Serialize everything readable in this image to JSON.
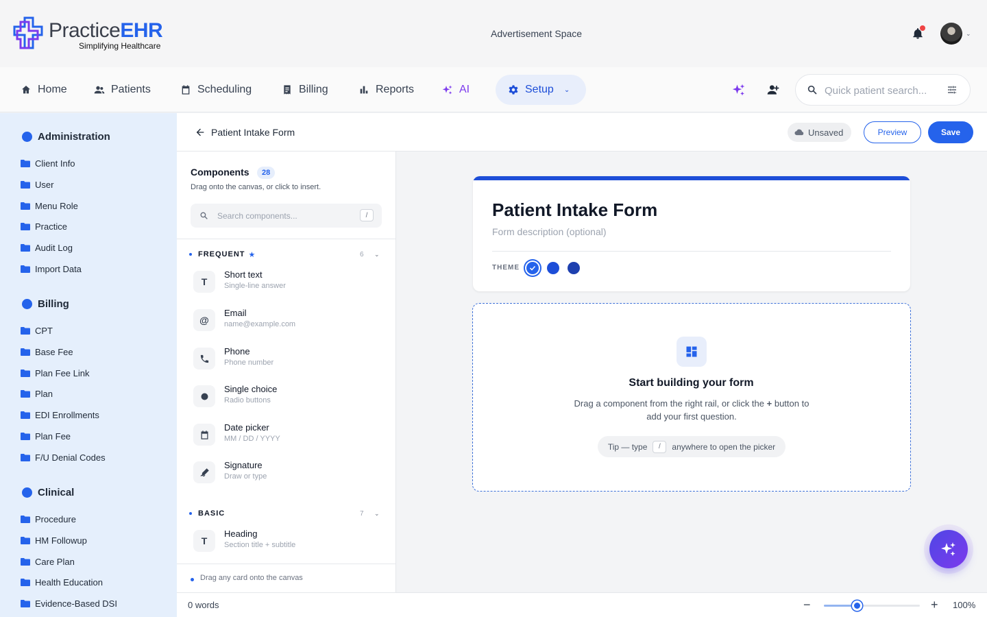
{
  "app": {
    "logo_name": "Practice",
    "logo_name_bold": "EHR",
    "tagline": "Simplifying Healthcare",
    "ad_space": "Advertisement Space",
    "brand_color": "#2563eb"
  },
  "nav": {
    "items": [
      {
        "label": "Home",
        "icon": "home-icon"
      },
      {
        "label": "Patients",
        "icon": "patients-icon"
      },
      {
        "label": "Scheduling",
        "icon": "calendar-icon"
      },
      {
        "label": "Billing",
        "icon": "receipt-icon"
      },
      {
        "label": "Reports",
        "icon": "bar-chart-icon"
      },
      {
        "label": "AI",
        "icon": "sparkle-icon"
      }
    ],
    "active": {
      "label": "Setup",
      "icon": "gear-icon"
    },
    "quick_search_placeholder": "Quick patient search..."
  },
  "sidebar": {
    "groups": [
      {
        "title": "Administration",
        "items": [
          "Client Info",
          "User",
          "Menu Role",
          "Practice",
          "Audit Log",
          "Import Data"
        ]
      },
      {
        "title": "Billing",
        "items": [
          "CPT",
          "Base Fee",
          "Plan Fee Link",
          "Plan",
          "EDI Enrollments",
          "Plan Fee",
          "F/U Denial Codes"
        ]
      },
      {
        "title": "Clinical",
        "items": [
          "Procedure",
          "HM Followup",
          "Care Plan",
          "Health Education",
          "Evidence-Based DSI"
        ]
      }
    ]
  },
  "form_header": {
    "title": "Patient Intake Form",
    "status": "Unsaved",
    "preview_label": "Preview",
    "save_label": "Save"
  },
  "components": {
    "title": "Components",
    "count": "28",
    "subtitle": "Drag onto the canvas, or click to insert.",
    "search_placeholder": "Search components...",
    "search_shortcut": "/",
    "sections": [
      {
        "name": "FREQUENT",
        "count": "6",
        "items": [
          {
            "label": "Short text",
            "hint": "Single-line answer",
            "icon": "T"
          },
          {
            "label": "Email",
            "hint": "name@example.com",
            "icon": "@"
          },
          {
            "label": "Phone",
            "hint": "Phone number",
            "icon": "phone-icon"
          },
          {
            "label": "Single choice",
            "hint": "Radio buttons",
            "icon": "radio-icon"
          },
          {
            "label": "Date picker",
            "hint": "MM / DD / YYYY",
            "icon": "calendar-icon"
          },
          {
            "label": "Signature",
            "hint": "Draw or type",
            "icon": "signature-icon"
          }
        ]
      },
      {
        "name": "BASIC",
        "count": "7",
        "items": [
          {
            "label": "Heading",
            "hint": "Section title + subtitle",
            "icon": "T"
          }
        ]
      }
    ],
    "footer": "Drag any card onto the canvas"
  },
  "canvas": {
    "form_title": "Patient Intake Form",
    "form_description_placeholder": "Form description (optional)",
    "theme_label": "THEME",
    "theme_colors": [
      "#2563eb",
      "#1d4ed8",
      "#1e40af"
    ],
    "empty_title": "Start building your form",
    "empty_desc_1": "Drag a component from the right rail, or click the",
    "empty_desc_plus": "+",
    "empty_desc_2": "button to add your first question.",
    "tip_prefix": "Tip — type",
    "tip_key": "/",
    "tip_suffix": "anywhere to open the picker"
  },
  "statusbar": {
    "words": "0 words",
    "zoom_percent": 34,
    "zoom_value": "100%"
  }
}
